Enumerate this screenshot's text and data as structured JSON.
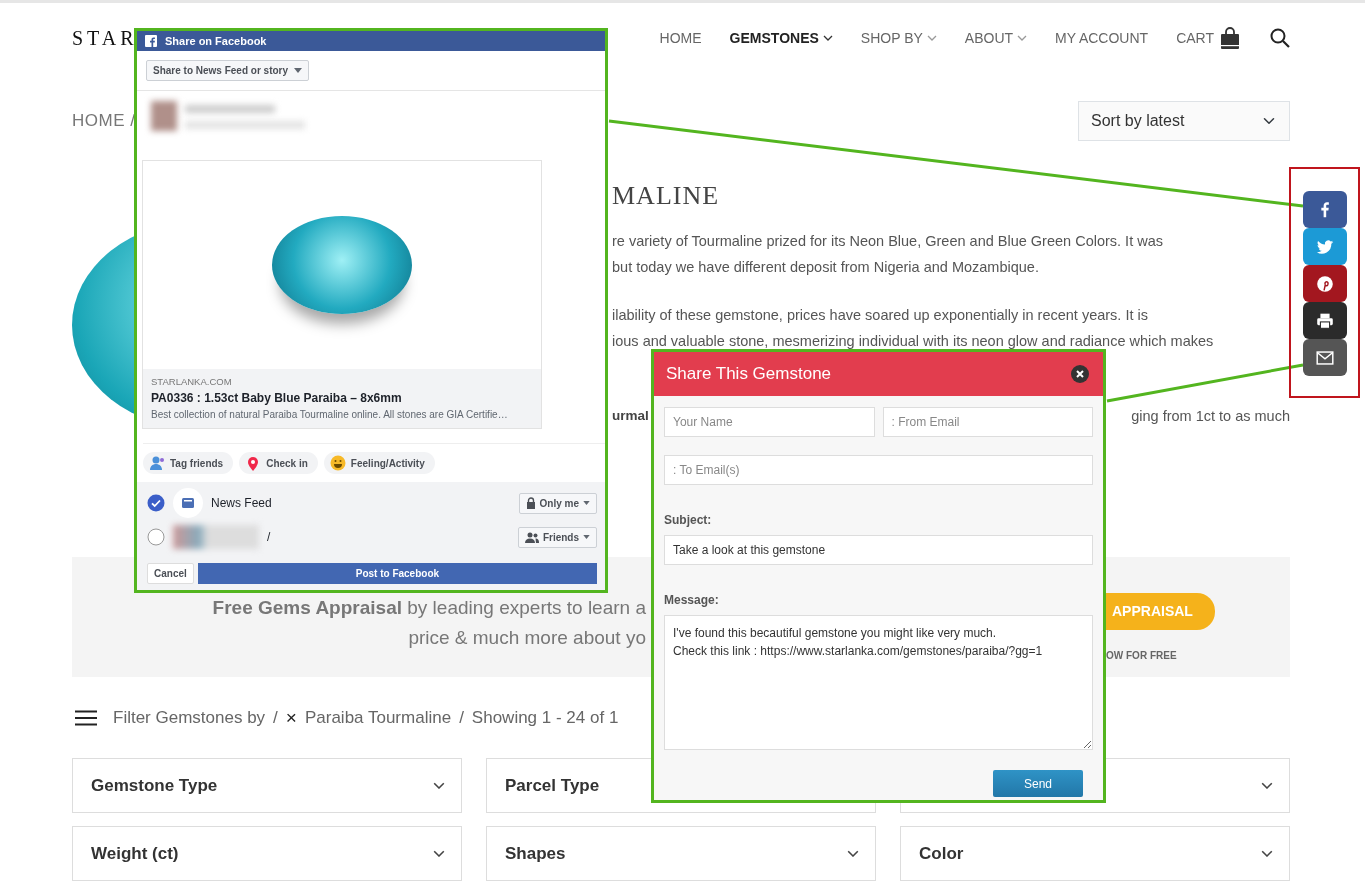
{
  "header": {
    "logo": "STAR",
    "nav": [
      {
        "label": "HOME",
        "selected": false,
        "dropdown": false
      },
      {
        "label": "GEMSTONES",
        "selected": true,
        "dropdown": true
      },
      {
        "label": "SHOP BY",
        "selected": false,
        "dropdown": true
      },
      {
        "label": "ABOUT",
        "selected": false,
        "dropdown": true
      },
      {
        "label": "MY ACCOUNT",
        "selected": false,
        "dropdown": false
      }
    ],
    "cart": "CART"
  },
  "breadcrumb": "HOME /",
  "sort": {
    "value": "Sort by latest"
  },
  "product": {
    "title": "MALINE",
    "description": [
      {
        "kind": "lines",
        "lines": [
          "re variety of Tourmaline prized for its Neon Blue, Green and Blue Green Colors. It was",
          "but today we have different deposit from Nigeria and Mozambique."
        ]
      },
      {
        "kind": "lines",
        "lines": [
          "ilability of these gemstone, prices have soared up exponentially in recent years. It is",
          "ious and valuable stone, mesmerizing individual with its neon glow and radiance which makes"
        ]
      },
      {
        "kind": "split",
        "left": "urmal",
        "right": "ging from 1ct to as much"
      }
    ]
  },
  "banner": {
    "line1": "**Free Gems Appraisal** by leading experts to learn a",
    "line2": "price & much more about yo",
    "button": "APPRAISAL",
    "note": "OW FOR FREE"
  },
  "filter_bar": {
    "parts": [
      {
        "kind": "text",
        "text": "Filter Gemstones by"
      },
      {
        "kind": "separator",
        "text": "/"
      },
      {
        "kind": "remove",
        "text": "×"
      },
      {
        "kind": "text",
        "text": "Paraiba Tourmaline"
      },
      {
        "kind": "separator",
        "text": "/"
      },
      {
        "kind": "text",
        "text": "Showing 1 - 24 of 1"
      }
    ]
  },
  "filters": [
    {
      "kind": "labeled",
      "label": "Gemstone Type"
    },
    {
      "kind": "labeled",
      "label": "Parcel Type"
    },
    {
      "kind": "covered"
    },
    {
      "kind": "labeled",
      "label": "Weight (ct)"
    },
    {
      "kind": "labeled",
      "label": "Shapes"
    },
    {
      "kind": "labeled",
      "label": "Color"
    }
  ],
  "share_bar": {
    "buttons": [
      {
        "kind": "facebook",
        "color": "#3b5998"
      },
      {
        "kind": "twitter",
        "color": "#1c9ad6"
      },
      {
        "kind": "pinterest",
        "color": "#a3171f"
      },
      {
        "kind": "print",
        "color": "#2b2b2b"
      },
      {
        "kind": "email",
        "color": "#555555"
      }
    ]
  },
  "facebook_dialog": {
    "title": "Share on Facebook",
    "audience_menu": "Share to News Feed or story",
    "preview": {
      "domain": "STARLANKA.COM",
      "title": "PA0336 : 1.53ct Baby Blue Paraiba – 8x6mm",
      "description": "Best collection of natural Paraiba Tourmaline online. All stones are GIA Certifie…"
    },
    "actions": [
      {
        "kind": "tag",
        "label": "Tag friends"
      },
      {
        "kind": "checkin",
        "label": "Check in"
      },
      {
        "kind": "feeling",
        "label": "Feeling/Activity"
      }
    ],
    "destinations": [
      {
        "kind": "feed",
        "label": "News Feed",
        "selected": true,
        "privacy": {
          "kind": "lock",
          "label": "Only me"
        }
      },
      {
        "kind": "profile",
        "label": "/",
        "selected": false,
        "privacy": {
          "kind": "friends",
          "label": "Friends"
        }
      }
    ],
    "cancel": "Cancel",
    "post": "Post to Facebook"
  },
  "share_dialog": {
    "title": "Share This Gemstone",
    "name": {
      "placeholder": "Your Name"
    },
    "from": {
      "placeholder": ": From Email"
    },
    "to": {
      "placeholder": ": To Email(s)"
    },
    "subject_label": "Subject:",
    "subject": "Take a look at this gemstone",
    "message_label": "Message:",
    "message": "I've found this becautiful gemstone you might like very much.\nCheck this link : https://www.starlanka.com/gemstones/paraiba/?gg=1",
    "send": "Send"
  }
}
